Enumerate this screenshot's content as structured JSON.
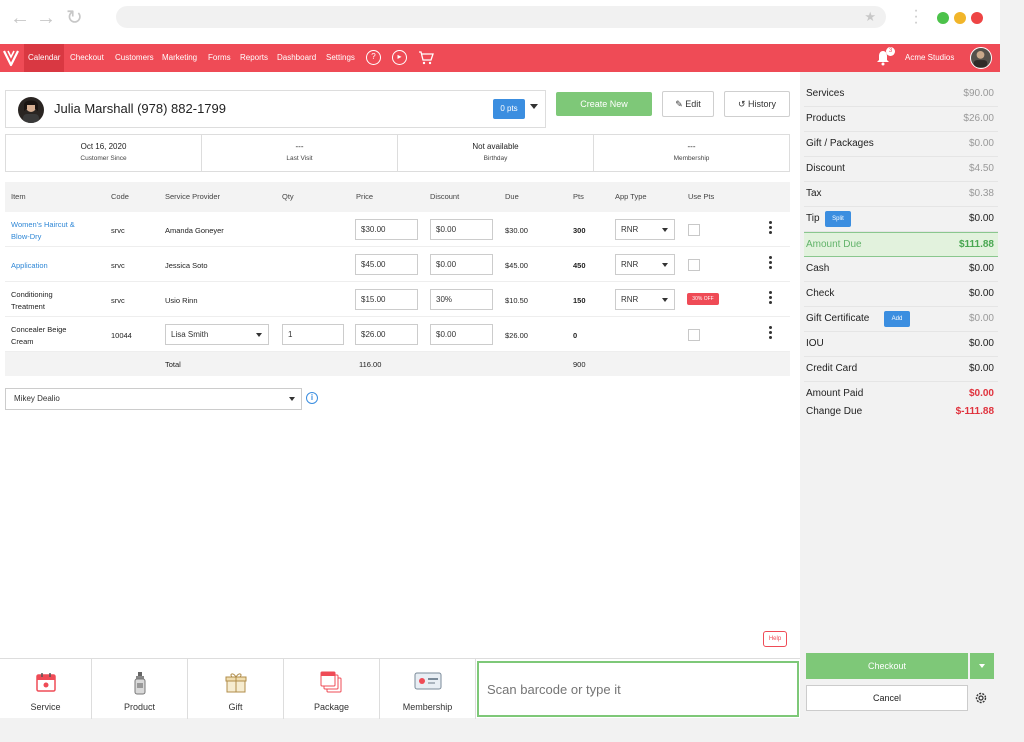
{
  "nav": {
    "items": [
      "Calendar",
      "Checkout",
      "Customers",
      "Marketing",
      "Forms",
      "Reports",
      "Dashboard",
      "Settings"
    ],
    "notification_count": "3",
    "studio_name": "Acme Studios"
  },
  "customer": {
    "name": "Julia Marshall (978) 882-1799",
    "points": "0 pts",
    "create_label": "Create New",
    "edit_label": "Edit",
    "history_label": "History"
  },
  "stats": [
    {
      "value": "Oct 16, 2020",
      "label": "Customer Since"
    },
    {
      "value": "---",
      "label": "Last Visit"
    },
    {
      "value": "Not available",
      "label": "Birthday"
    },
    {
      "value": "---",
      "label": "Membership"
    }
  ],
  "table": {
    "headers": [
      "Item",
      "Code",
      "Service Provider",
      "Qty",
      "Price",
      "Discount",
      "Due",
      "Pts",
      "App Type",
      "Use Pts"
    ],
    "rows": [
      {
        "item1": "Women's Haircut &",
        "item2": "Blow-Dry",
        "code": "srvc",
        "provider": "Amanda Goneyer",
        "qty": "",
        "price": "$30.00",
        "discount": "$0.00",
        "due": "$30.00",
        "pts": "300",
        "app_type": "RNR",
        "badge": ""
      },
      {
        "item1": "Application",
        "item2": "",
        "code": "srvc",
        "provider": "Jessica Soto",
        "qty": "",
        "price": "$45.00",
        "discount": "$0.00",
        "due": "$45.00",
        "pts": "450",
        "app_type": "RNR",
        "badge": ""
      },
      {
        "item1": "Conditioning",
        "item2": "Treatment",
        "code": "srvc",
        "provider": "Usio Rinn",
        "qty": "",
        "price": "$15.00",
        "discount": "30%",
        "due": "$10.50",
        "pts": "150",
        "app_type": "RNR",
        "badge": "30% OFF"
      },
      {
        "item1": "Concealer Beige",
        "item2": "Cream",
        "code": "10044",
        "provider": "Lisa Smith",
        "qty": "1",
        "price": "$26.00",
        "discount": "$0.00",
        "due": "$26.00",
        "pts": "0",
        "app_type": "",
        "badge": ""
      }
    ],
    "total_label": "Total",
    "total_price": "116.00",
    "total_pts": "900"
  },
  "staff": "Mikey Dealio",
  "help_label": "Help",
  "bottom": {
    "tiles": [
      "Service",
      "Product",
      "Gift",
      "Package",
      "Membership"
    ],
    "scan_placeholder": "Scan barcode or type it"
  },
  "summary": {
    "rows": [
      {
        "label": "Services",
        "value": "$90.00"
      },
      {
        "label": "Products",
        "value": "$26.00"
      },
      {
        "label": "Gift / Packages",
        "value": "$0.00"
      },
      {
        "label": "Discount",
        "value": "$4.50"
      },
      {
        "label": "Tax",
        "value": "$0.38"
      },
      {
        "label": "Tip",
        "value": "$0.00",
        "chip": "Split"
      },
      {
        "label": "Amount Due",
        "value": "$111.88"
      },
      {
        "label": "Cash",
        "value": "$0.00"
      },
      {
        "label": "Check",
        "value": "$0.00"
      },
      {
        "label": "Gift Certificate",
        "value": "$0.00",
        "chip": "Add"
      },
      {
        "label": "IOU",
        "value": "$0.00"
      },
      {
        "label": "Credit Card",
        "value": "$0.00"
      }
    ],
    "amount_paid_label": "Amount Paid",
    "amount_paid": "$0.00",
    "change_due_label": "Change Due",
    "change_due": "$-111.88",
    "checkout_label": "Checkout",
    "cancel_label": "Cancel"
  },
  "colors": {
    "brand": "#ef4b56",
    "accent_green": "#7ec878",
    "accent_blue": "#3b8ee0"
  }
}
